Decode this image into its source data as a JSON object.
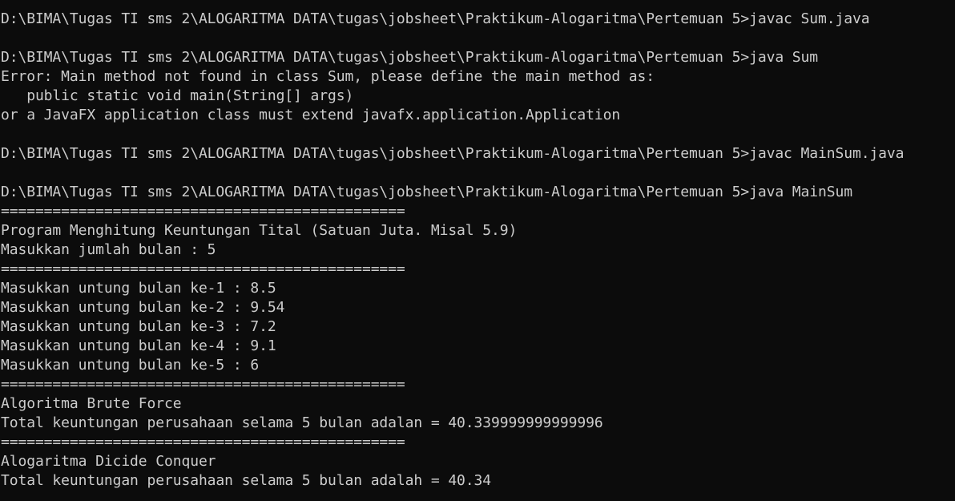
{
  "terminal": {
    "colors": {
      "background": "#0c0c0c",
      "foreground": "#cccccc"
    },
    "lines": [
      "D:\\BIMA\\Tugas TI sms 2\\ALOGARITMA DATA\\tugas\\jobsheet\\Praktikum-Alogaritma\\Pertemuan 5>javac Sum.java",
      "",
      "D:\\BIMA\\Tugas TI sms 2\\ALOGARITMA DATA\\tugas\\jobsheet\\Praktikum-Alogaritma\\Pertemuan 5>java Sum",
      "Error: Main method not found in class Sum, please define the main method as:",
      "   public static void main(String[] args)",
      "or a JavaFX application class must extend javafx.application.Application",
      "",
      "D:\\BIMA\\Tugas TI sms 2\\ALOGARITMA DATA\\tugas\\jobsheet\\Praktikum-Alogaritma\\Pertemuan 5>javac MainSum.java",
      "",
      "D:\\BIMA\\Tugas TI sms 2\\ALOGARITMA DATA\\tugas\\jobsheet\\Praktikum-Alogaritma\\Pertemuan 5>java MainSum",
      "===============================================",
      "Program Menghitung Keuntungan Tital (Satuan Juta. Misal 5.9)",
      "Masukkan jumlah bulan : 5",
      "===============================================",
      "Masukkan untung bulan ke-1 : 8.5",
      "Masukkan untung bulan ke-2 : 9.54",
      "Masukkan untung bulan ke-3 : 7.2",
      "Masukkan untung bulan ke-4 : 9.1",
      "Masukkan untung bulan ke-5 : 6",
      "===============================================",
      "Algoritma Brute Force",
      "Total keuntungan perusahaan selama 5 bulan adalan = 40.339999999999996",
      "===============================================",
      "Alogaritma Dicide Conquer",
      "Total keuntungan perusahaan selama 5 bulan adalah = 40.34"
    ]
  }
}
